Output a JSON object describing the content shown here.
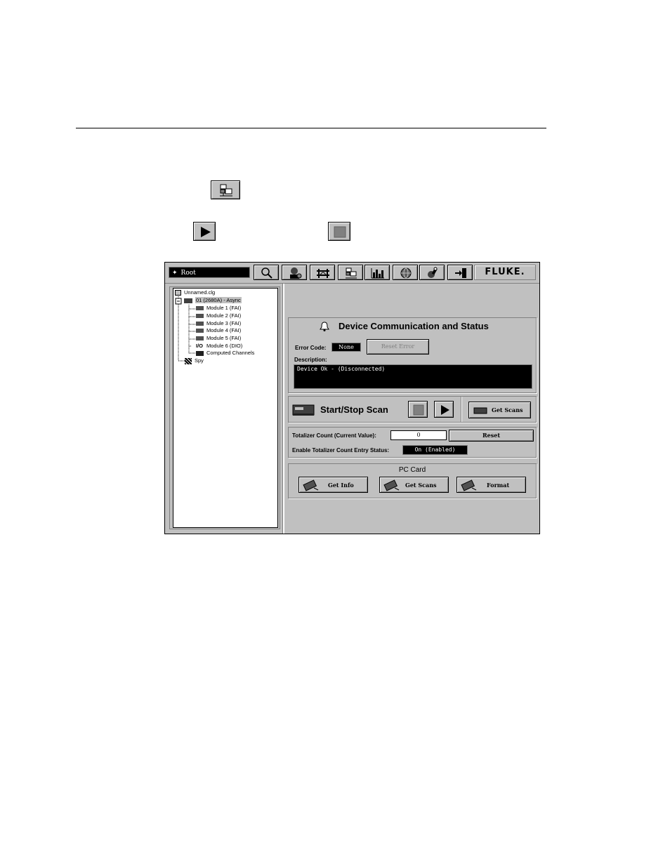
{
  "colors": {
    "window_bg": "#c0c0c0",
    "field_bg": "#000000",
    "tree_bg": "#ffffff"
  },
  "document": {
    "inline_icons": [
      "network-setup-icon",
      "play-icon",
      "stop-icon"
    ]
  },
  "app": {
    "path": "Root",
    "brand": "FLUKE.",
    "toolbar_icons": [
      "search-icon",
      "operator-icon",
      "bridge-icon",
      "network-setup-icon",
      "chart-icon",
      "globe-icon",
      "tools-icon",
      "exit-icon"
    ],
    "tree": {
      "root": "Unnamed.clg",
      "device": "01 (2680A) - Async",
      "modules": [
        "Module 1 (FAI)",
        "Module 2 (FAI)",
        "Module 3 (FAI)",
        "Module 4 (FAI)",
        "Module 5 (FAI)",
        "Module 6 (DIO)"
      ],
      "module_prefix_io": "I/O",
      "computed": "Computed Channels",
      "spy": "Spy"
    },
    "comm": {
      "title": "Device Communication and Status",
      "error_code_label": "Error Code:",
      "error_code_value": "None",
      "reset_error": "Reset Error",
      "description_label": "Description:",
      "description_value": "Device Ok -  (Disconnected)"
    },
    "scan": {
      "title": "Start/Stop Scan",
      "get_scans": "Get Scans"
    },
    "totalizer": {
      "count_label": "Totalizer Count (Current Value):",
      "count_value": "0",
      "reset": "Reset",
      "entry_status_label": "Enable Totalizer Count Entry Status:",
      "entry_status_value": "On (Enabled)"
    },
    "pc_card": {
      "title": "PC Card",
      "get_info": "Get Info",
      "get_scans": "Get Scans",
      "format": "Format"
    }
  }
}
